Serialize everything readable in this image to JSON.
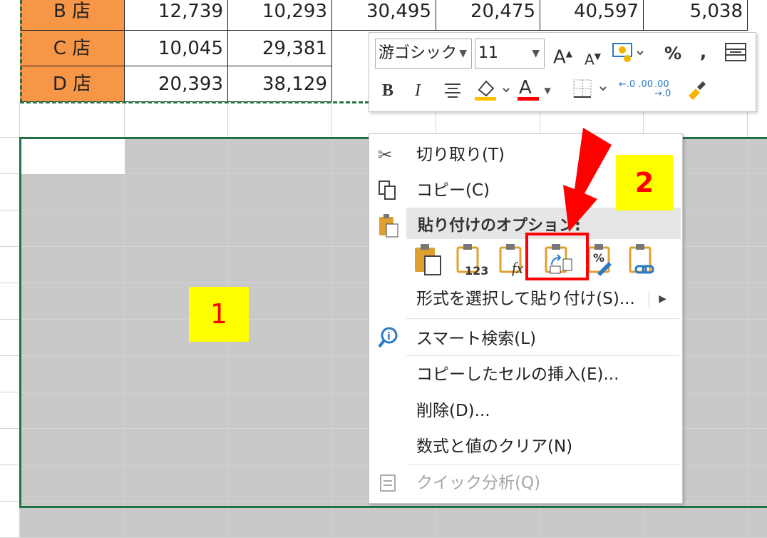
{
  "table": {
    "rows": [
      {
        "store": "B 店",
        "values": [
          "12,739",
          "10,293",
          "30,495",
          "20,475",
          "40,597",
          "5,038"
        ]
      },
      {
        "store": "C 店",
        "values": [
          "10,045",
          "29,381"
        ]
      },
      {
        "store": "D 店",
        "values": [
          "20,393",
          "38,129"
        ]
      }
    ]
  },
  "mini_toolbar": {
    "font_name": "游ゴシック",
    "font_size": "11",
    "buttons_row1": [
      "increase-font-size",
      "decrease-font-size",
      "accounting-format",
      "percent-style",
      "comma-style",
      "format-painter-table"
    ],
    "percent_label": "%",
    "comma_label": ",",
    "bold_label": "B",
    "italic_label": "I",
    "font_color_label": "A",
    "grow_label": "A",
    "shrink_label": "A",
    "inc_decimal_label": "←.0 .00",
    "dec_decimal_label": ".00 →.0"
  },
  "context_menu": {
    "cut": "切り取り(T)",
    "copy": "コピー(C)",
    "paste_options_header": "貼り付けのオプション:",
    "paste_special": "形式を選択して貼り付け(S)...",
    "smart_lookup": "スマート検索(L)",
    "insert_copied": "コピーしたセルの挿入(E)...",
    "delete": "削除(D)...",
    "clear_contents": "数式と値のクリア(N)",
    "quick_analysis": "クイック分析(Q)",
    "paste_icon_values_label": "123",
    "paste_icon_formula_label": "fx",
    "paste_icon_format_label": "%"
  },
  "annotations": {
    "label1": "1",
    "label2": "2"
  },
  "colors": {
    "store_fill": "#f79646",
    "selection_fill": "#c9c9c9",
    "excel_green": "#217346",
    "annotation_red": "#ff0000",
    "annotation_yellow": "#ffff00"
  }
}
